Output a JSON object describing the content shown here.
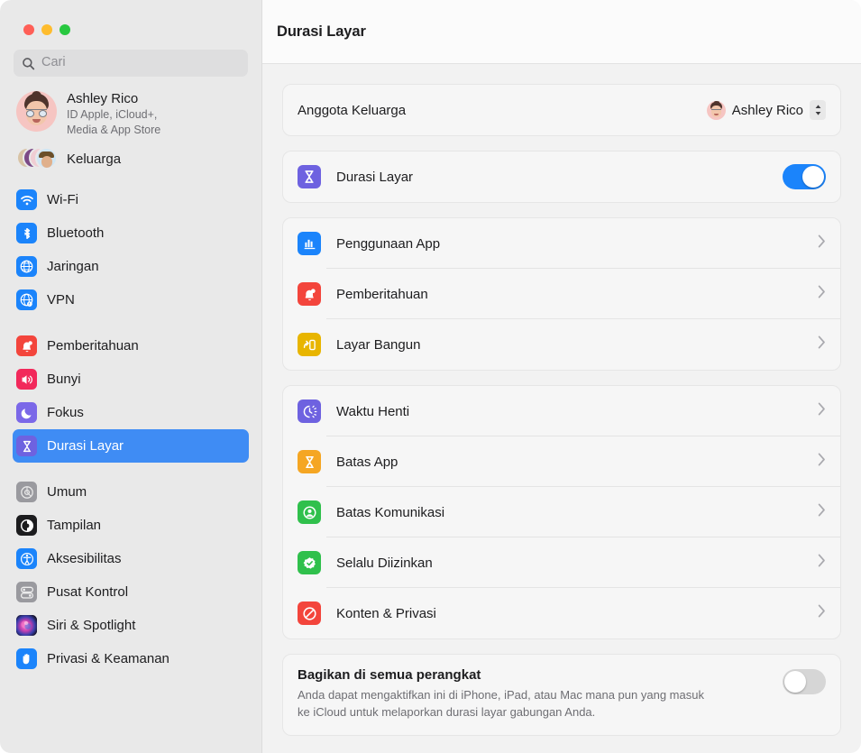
{
  "window": {
    "traffic_lights": [
      "close",
      "minimize",
      "zoom"
    ],
    "accent_color": "#3f8cf4",
    "toggle_on_color": "#1b84fb"
  },
  "sidebar": {
    "search": {
      "placeholder": "Cari",
      "icon": "search-icon"
    },
    "account": {
      "name": "Ashley Rico",
      "subtitle_line1": "ID Apple, iCloud+,",
      "subtitle_line2": "Media & App Store",
      "avatar": "memoji-avatar"
    },
    "family": {
      "label": "Keluarga",
      "icon": "family-avatars-icon"
    },
    "groups": [
      {
        "items": [
          {
            "label": "Wi-Fi",
            "icon": "wifi-icon",
            "color": "#1b84fb",
            "selected": false
          },
          {
            "label": "Bluetooth",
            "icon": "bluetooth-icon",
            "color": "#1b84fb",
            "selected": false
          },
          {
            "label": "Jaringan",
            "icon": "globe-icon",
            "color": "#1b84fb",
            "selected": false
          },
          {
            "label": "VPN",
            "icon": "globe-vpn-icon",
            "color": "#1b84fb",
            "selected": false
          }
        ]
      },
      {
        "items": [
          {
            "label": "Pemberitahuan",
            "icon": "bell-icon",
            "color": "#f3453c",
            "selected": false
          },
          {
            "label": "Bunyi",
            "icon": "speaker-icon",
            "color": "#f2295b",
            "selected": false
          },
          {
            "label": "Fokus",
            "icon": "moon-icon",
            "color": "#7b68e8",
            "selected": false
          },
          {
            "label": "Durasi Layar",
            "icon": "hourglass-icon",
            "color": "#6e62e0",
            "selected": true
          }
        ]
      },
      {
        "items": [
          {
            "label": "Umum",
            "icon": "gear-icon",
            "color": "#8e8e93",
            "selected": false
          },
          {
            "label": "Tampilan",
            "icon": "appearance-icon",
            "color": "#1c1c1e",
            "selected": false
          },
          {
            "label": "Aksesibilitas",
            "icon": "accessibility-icon",
            "color": "#1b84fb",
            "selected": false
          },
          {
            "label": "Pusat Kontrol",
            "icon": "control-center-icon",
            "color": "#8e8e93",
            "selected": false
          },
          {
            "label": "Siri & Spotlight",
            "icon": "siri-icon",
            "color": "#3a2b50",
            "selected": false
          },
          {
            "label": "Privasi & Keamanan",
            "icon": "hand-privacy-icon",
            "color": "#1b84fb",
            "selected": false
          }
        ]
      }
    ]
  },
  "main": {
    "title": "Durasi Layar",
    "family_member_row": {
      "label": "Anggota Keluarga",
      "selected_value": "Ashley Rico",
      "control": "popup-button"
    },
    "screen_time_row": {
      "label": "Durasi Layar",
      "icon": "hourglass-icon",
      "icon_color": "#6e62e0",
      "toggle_on": true
    },
    "usage_group": [
      {
        "label": "Penggunaan App",
        "icon": "bar-chart-icon",
        "color": "#1b84fb"
      },
      {
        "label": "Pemberitahuan",
        "icon": "bell-icon",
        "color": "#f3453c"
      },
      {
        "label": "Layar Bangun",
        "icon": "pickups-icon",
        "color": "#e8b500"
      }
    ],
    "limits_group": [
      {
        "label": "Waktu Henti",
        "icon": "downtime-clock-icon",
        "color": "#6e62e0"
      },
      {
        "label": "Batas App",
        "icon": "hourglass-icon",
        "color": "#f5a623"
      },
      {
        "label": "Batas Komunikasi",
        "icon": "person-circle-icon",
        "color": "#30c04c"
      },
      {
        "label": "Selalu Diizinkan",
        "icon": "checkmark-seal-icon",
        "color": "#30c04c"
      },
      {
        "label": "Konten & Privasi",
        "icon": "no-entry-icon",
        "color": "#f3453c"
      }
    ],
    "share_section": {
      "title": "Bagikan di semua perangkat",
      "description_line1": "Anda dapat mengaktifkan ini di iPhone, iPad, atau Mac mana pun yang masuk",
      "description_line2": "ke iCloud untuk melaporkan durasi layar gabungan Anda.",
      "toggle_on": false
    }
  }
}
